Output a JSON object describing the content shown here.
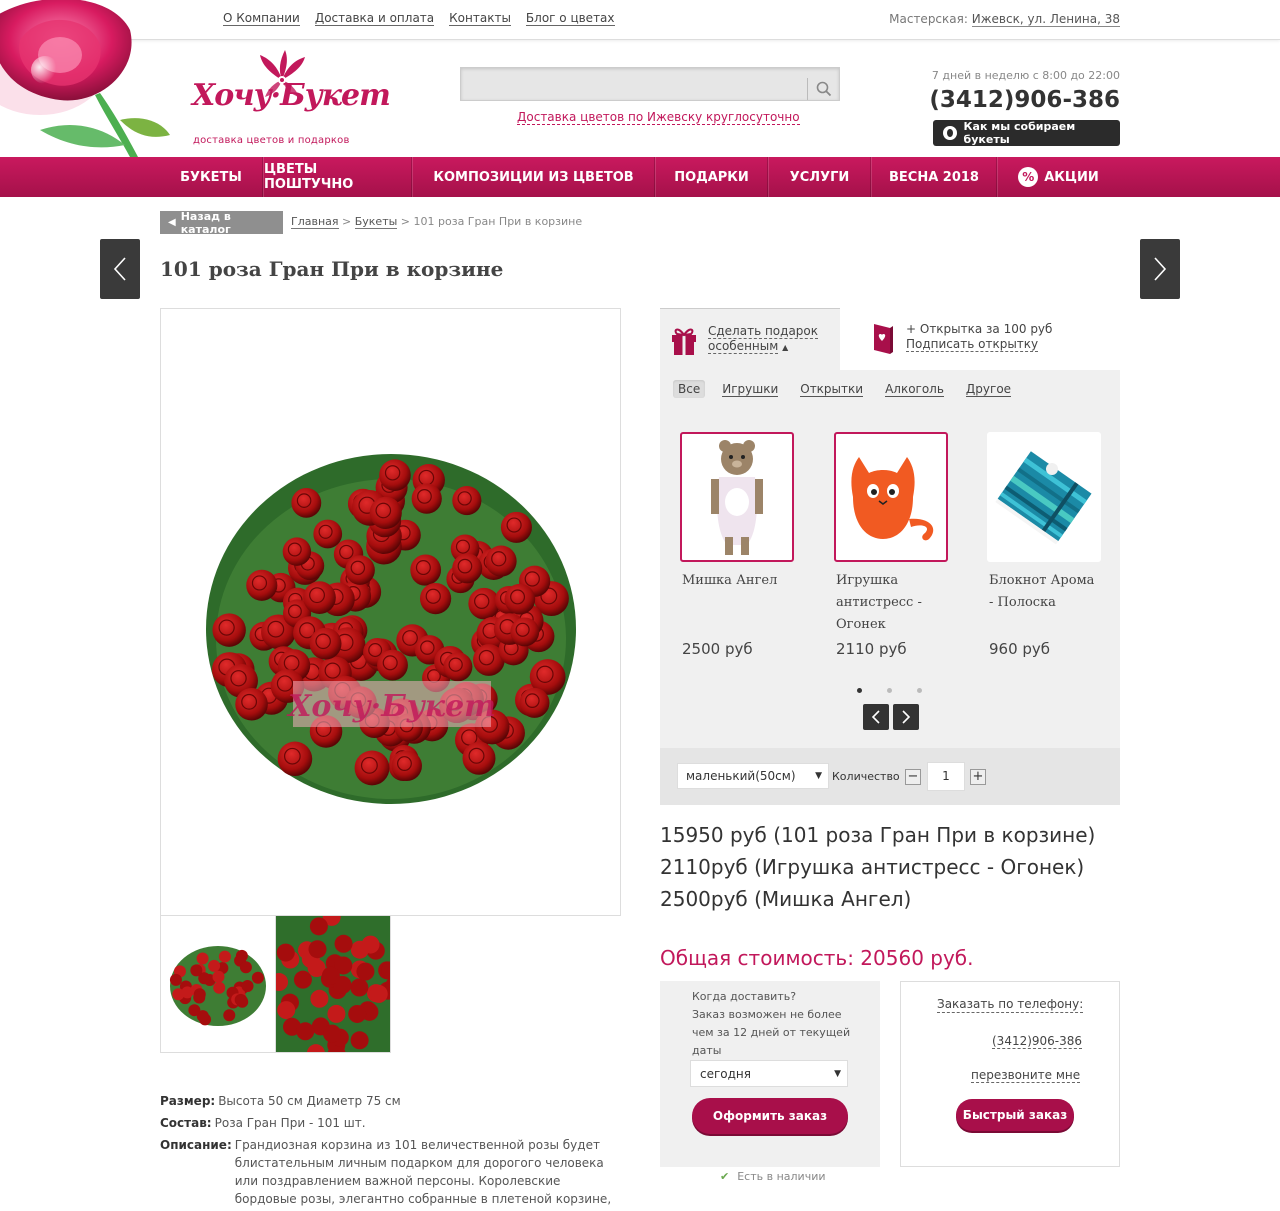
{
  "top_links": [
    "О Компании",
    "Доставка и оплата",
    "Контакты",
    "Блог о цветах"
  ],
  "workshop": {
    "label": "Мастерская:",
    "address": "Ижевск, ул. Ленина, 38"
  },
  "logo": {
    "name": "Хочу·Букет",
    "tagline": "доставка цветов и подарков"
  },
  "search": {
    "placeholder": ""
  },
  "delivery_link": "Доставка цветов по Ижевску круглосуточно",
  "contact": {
    "hours": "7 дней в неделю с 8:00 до 22:00",
    "phone": "(3412)906-386",
    "how_button": "Как мы собираем букеты"
  },
  "nav": [
    "БУКЕТЫ",
    "ЦВЕТЫ ПОШТУЧНО",
    "КОМПОЗИЦИИ ИЗ ЦВЕТОВ",
    "ПОДАРКИ",
    "УСЛУГИ",
    "ВЕСНА 2018",
    "АКЦИИ"
  ],
  "breadcrumb": {
    "back": "Назад в каталог",
    "home": "Главная",
    "sep": ">",
    "section": "Букеты",
    "current": "101 роза Гран При в корзине"
  },
  "product": {
    "title": "101 роза Гран При в корзине",
    "watermark": "Хочу·Букет",
    "size_label": "Размер:",
    "size": "Высота 50 см Диаметр 75 см",
    "composition_label": "Состав:",
    "composition": "Роза Гран При - 101 шт.",
    "description_label": "Описание:",
    "description": "Грандиозная корзина из 101 величественной розы будет блистательным личным подарком для дорогого человека или поздравлением важной персоны. Королевские бордовые розы, элегантно собранные в плетеной корзине, станут самым"
  },
  "gift_tabs": {
    "special": [
      "Сделать подарок",
      "особенным"
    ],
    "card": {
      "line1": "+ Открытка за 100 руб",
      "line2": "Подписать открытку"
    }
  },
  "filters": [
    "Все",
    "Игрушки",
    "Открытки",
    "Алкоголь",
    "Другое"
  ],
  "gifts": [
    {
      "name": "Мишка Ангел",
      "price": "2500 руб",
      "selected": true
    },
    {
      "name": "Игрушка антистресс - Огонек",
      "price": "2110 руб",
      "selected": true
    },
    {
      "name": "Блокнот Арома - Полоска",
      "price": "960 руб",
      "selected": false
    }
  ],
  "options": {
    "size": "маленький(50см)",
    "qty_label": "Количество",
    "qty": "1",
    "minus": "−",
    "plus": "+"
  },
  "price_lines": [
    "15950 руб (101 роза Гран При в корзине)",
    "2110руб (Игрушка антистресс - Огонек)",
    "2500руб (Мишка Ангел)"
  ],
  "total": "Общая стоимость: 20560 руб.",
  "order": {
    "when": "Когда доставить?",
    "note": "Заказ возможен не более чем за 12 дней от текущей даты",
    "date": "сегодня",
    "button": "Оформить заказ",
    "in_stock": "Есть в наличии"
  },
  "phone_order": {
    "label": "Заказать по телефону:",
    "phone": "(3412)906-386",
    "callback": "перезвоните мне",
    "button": "Быстрый заказ"
  },
  "colors": {
    "brand": "#c2185b",
    "nav": "#b5134f",
    "dark": "#333333"
  }
}
